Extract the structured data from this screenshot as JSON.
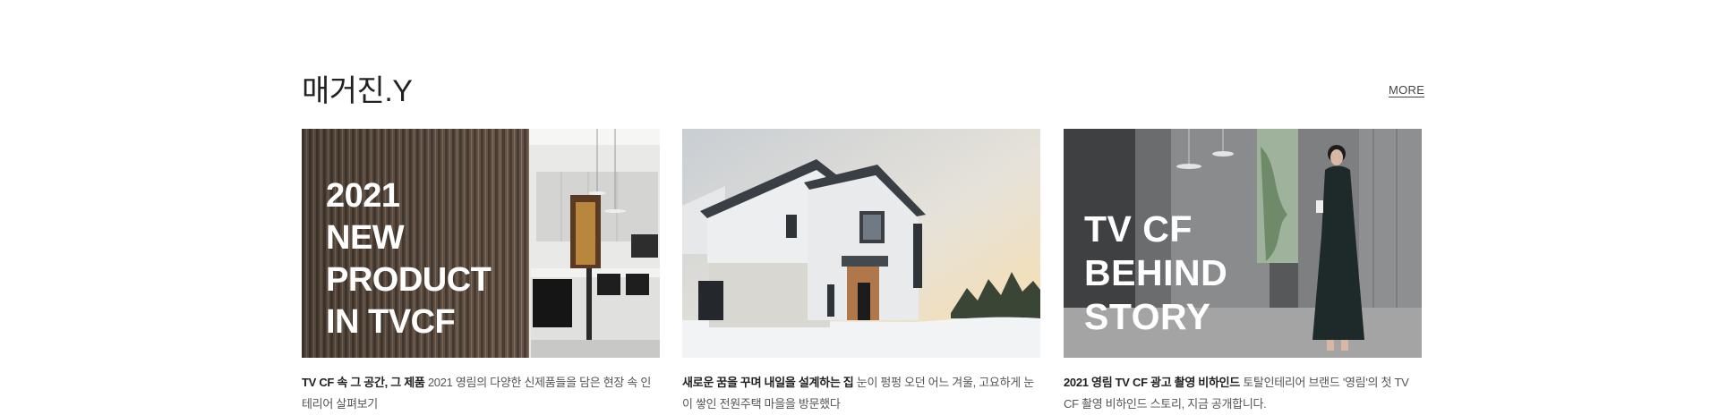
{
  "section": {
    "title": "매거진.Y",
    "more_label": "MORE"
  },
  "cards": [
    {
      "overlay_lines": [
        "2021",
        "NEW",
        "PRODUCT",
        "IN TVCF"
      ],
      "caption_bold": "TV CF 속 그 공간, 그 제품",
      "caption_text": " 2021 영림의 다양한 신제품들을 담은 현장 속 인테리어 살펴보기"
    },
    {
      "overlay_lines": [],
      "caption_bold": "새로운 꿈을 꾸며 내일을 설계하는 집",
      "caption_text": " 눈이 펑펑 오던 어느 겨울, 고요하게 눈이 쌓인 전원주택 마을을 방문했다"
    },
    {
      "overlay_lines": [
        "TV CF",
        "BEHIND",
        "STORY"
      ],
      "caption_bold": "2021 영림 TV CF 광고 촬영 비하인드",
      "caption_text": " 토탈인테리어 브랜드 '영림'의 첫 TV CF 촬영 비하인드 스토리, 지금 공개합니다."
    }
  ]
}
